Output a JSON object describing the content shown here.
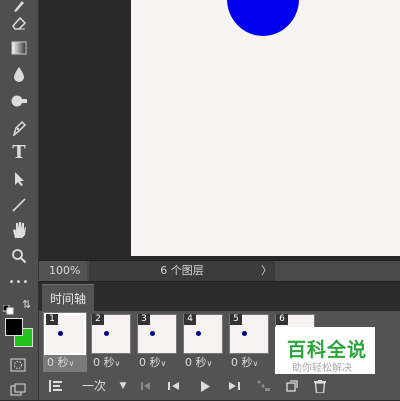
{
  "toolbar": {
    "tools": [
      {
        "name": "brush-icon"
      },
      {
        "name": "eraser-icon"
      },
      {
        "name": "gradient-icon"
      },
      {
        "name": "blur-drop-icon"
      },
      {
        "name": "dodge-icon"
      },
      {
        "name": "pen-icon"
      },
      {
        "name": "type-icon",
        "glyph": "T"
      },
      {
        "name": "path-select-icon"
      },
      {
        "name": "line-icon"
      },
      {
        "name": "hand-icon"
      },
      {
        "name": "zoom-icon"
      },
      {
        "name": "more-icon",
        "glyph": "•••"
      }
    ],
    "foreground_color": "#000000",
    "background_color": "#22c41a"
  },
  "canvas": {
    "shape_color": "#0000ee",
    "document_color": "#f8f4f3"
  },
  "status": {
    "zoom": "100%",
    "doc_info": "6 个图层",
    "arrow": "〉"
  },
  "timeline": {
    "tab_label": "时间轴",
    "frames": [
      {
        "number": "1",
        "delay": "0 秒"
      },
      {
        "number": "2",
        "delay": "0 秒"
      },
      {
        "number": "3",
        "delay": "0 秒"
      },
      {
        "number": "4",
        "delay": "0 秒"
      },
      {
        "number": "5",
        "delay": "0 秒"
      },
      {
        "number": "6",
        "delay": ""
      }
    ],
    "controls": {
      "loop": "一次"
    }
  },
  "watermark": {
    "title": "百科全说",
    "subtitle": "助你轻松解决"
  }
}
